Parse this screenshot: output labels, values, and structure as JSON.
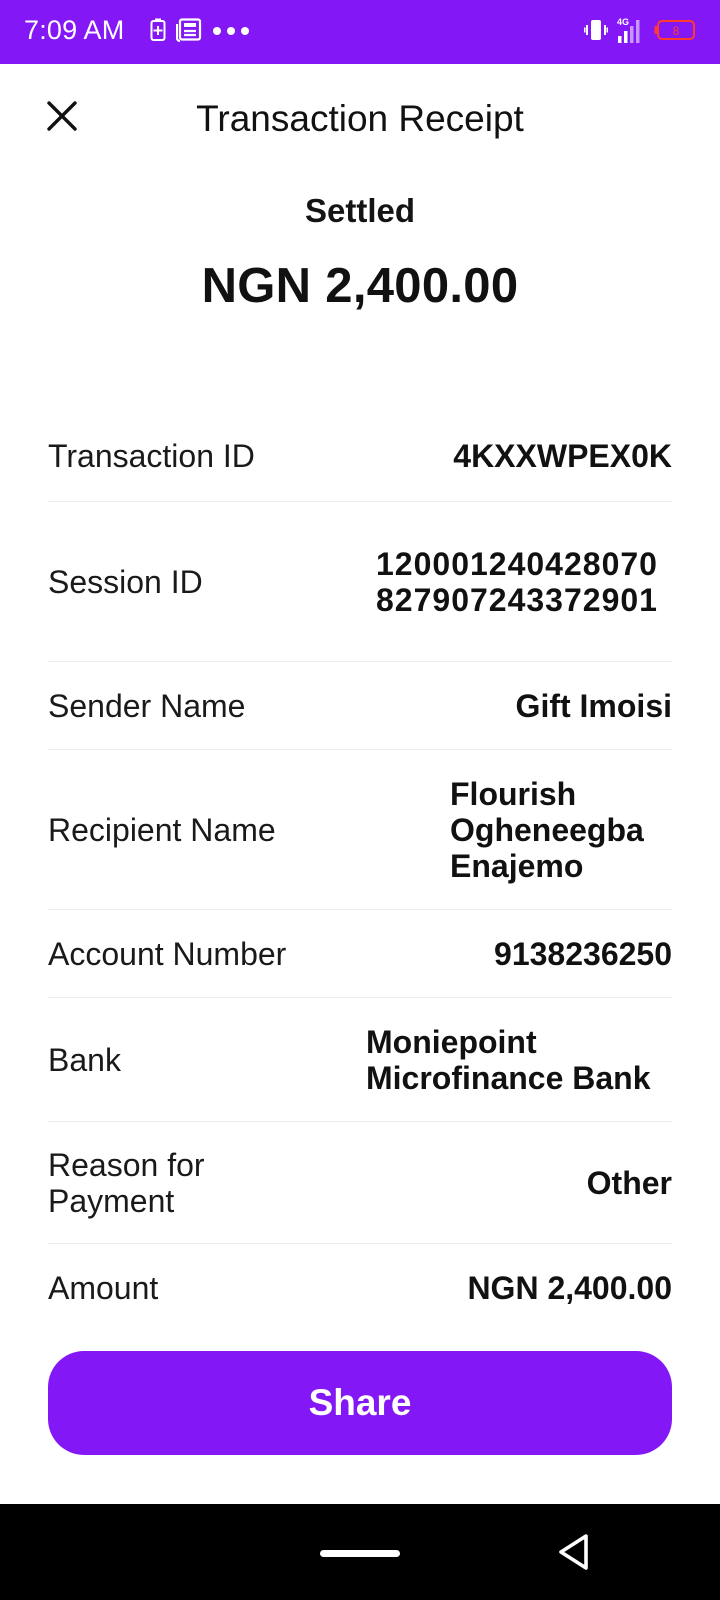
{
  "status_bar": {
    "time": "7:09 AM",
    "network": "4G",
    "battery_level": "8",
    "accent_color": "#8417f5"
  },
  "header": {
    "title": "Transaction Receipt",
    "close_icon": "close-icon"
  },
  "summary": {
    "status": "Settled",
    "amount": "NGN 2,400.00"
  },
  "details": [
    {
      "label": "Transaction ID",
      "value": "4KXXWPEX0K"
    },
    {
      "label": "Session ID",
      "value": "120001240428070827907243372901"
    },
    {
      "label": "Sender Name",
      "value": "Gift Imoisi"
    },
    {
      "label": "Recipient Name",
      "value": "Flourish Ogheneegba Enajemo"
    },
    {
      "label": "Account Number",
      "value": "9138236250"
    },
    {
      "label": "Bank",
      "value": "Moniepoint Microfinance Bank"
    },
    {
      "label": "Reason for Payment",
      "value": "Other"
    },
    {
      "label": "Amount",
      "value": "NGN 2,400.00"
    }
  ],
  "actions": {
    "share_label": "Share"
  }
}
